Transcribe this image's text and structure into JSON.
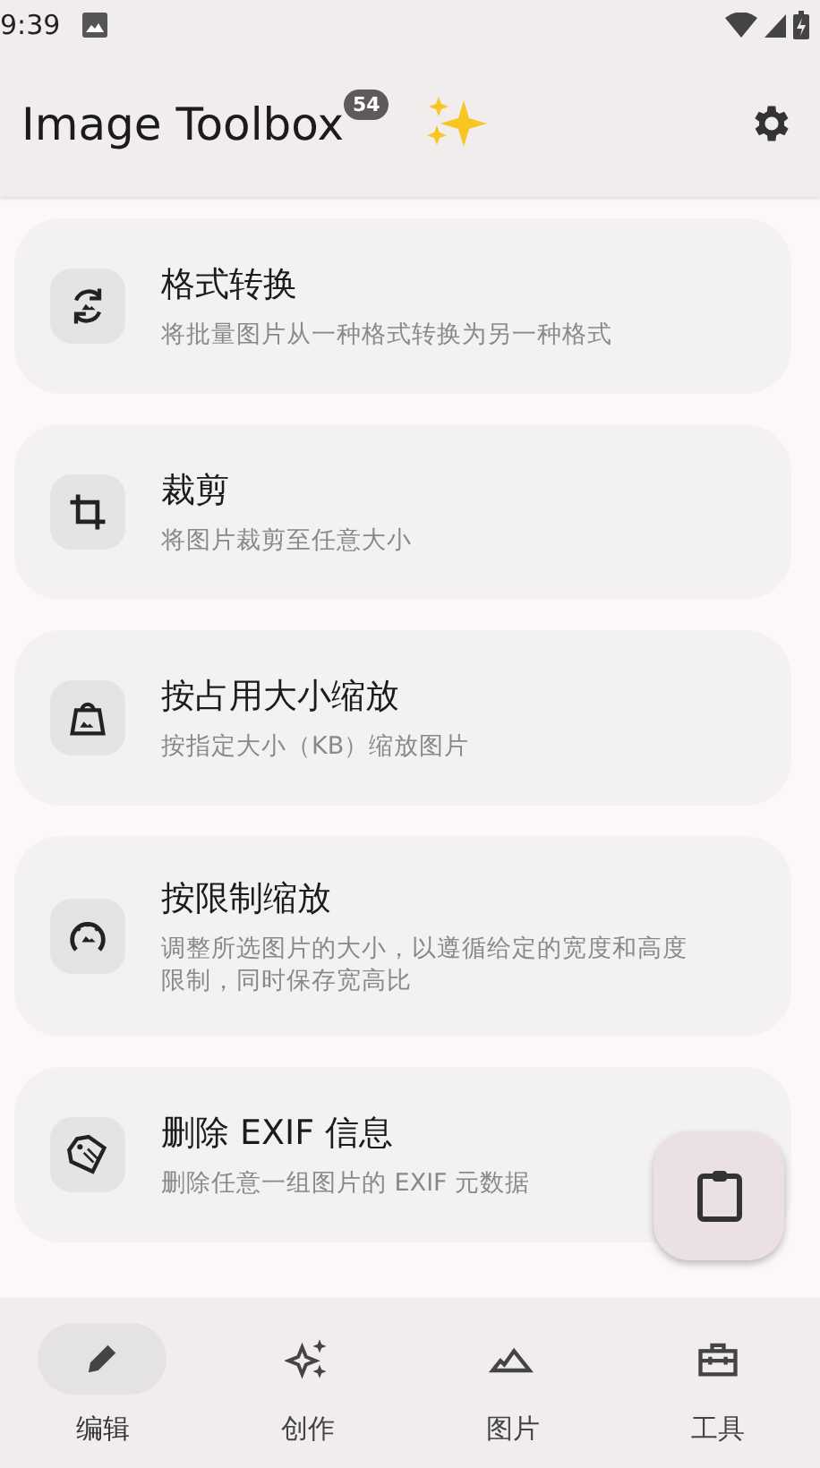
{
  "status_bar": {
    "time": "9:39"
  },
  "app_bar": {
    "title": "Image Toolbox",
    "badge": "54"
  },
  "tools": [
    {
      "kind": "convert",
      "title": "格式转换",
      "description": "将批量图片从一种格式转换为另一种格式"
    },
    {
      "kind": "crop",
      "title": "裁剪",
      "description": "将图片裁剪至任意大小"
    },
    {
      "kind": "weight",
      "title": "按占用大小缩放",
      "description": "按指定大小（KB）缩放图片"
    },
    {
      "kind": "limits",
      "title": "按限制缩放",
      "description": "调整所选图片的大小，以遵循给定的宽度和高度限制，同时保存宽高比"
    },
    {
      "kind": "exif",
      "title": "删除 EXIF 信息",
      "description": "删除任意一组图片的 EXIF 元数据"
    }
  ],
  "bottom_nav": [
    {
      "kind": "edit",
      "label": "编辑",
      "selected": true
    },
    {
      "kind": "create",
      "label": "创作",
      "selected": false
    },
    {
      "kind": "image",
      "label": "图片",
      "selected": false
    },
    {
      "kind": "tools",
      "label": "工具",
      "selected": false
    }
  ]
}
